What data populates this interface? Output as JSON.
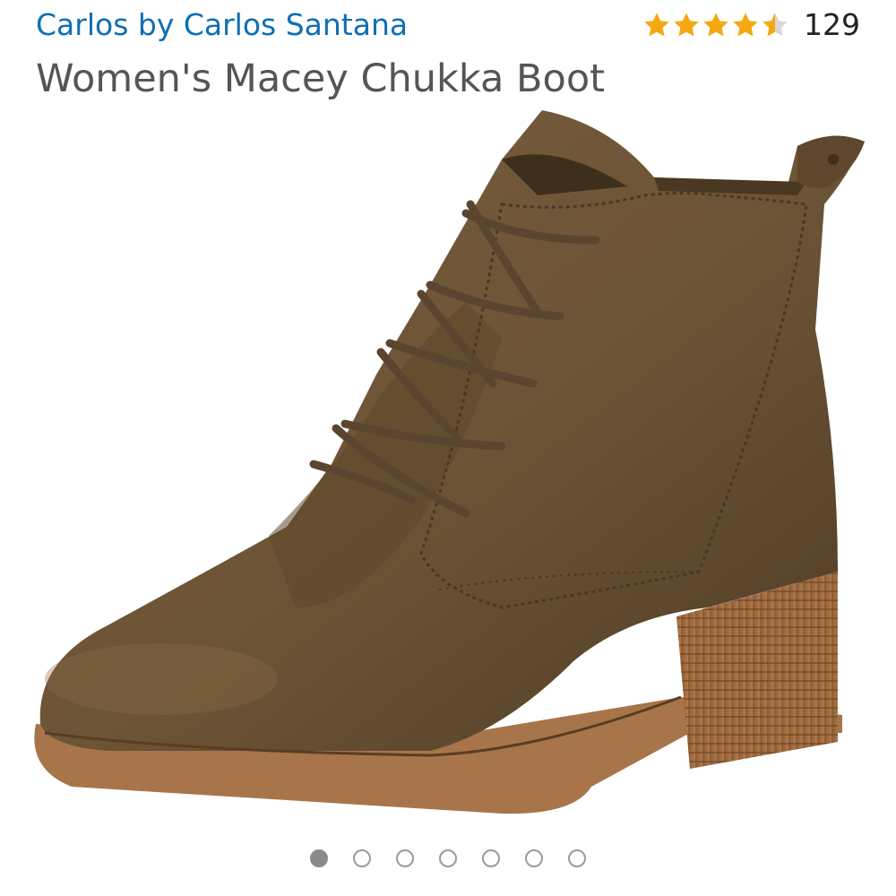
{
  "product": {
    "brand": "Carlos by Carlos Santana",
    "title": "Women's Macey Chukka Boot",
    "rating": {
      "stars": 4.5,
      "max_stars": 5,
      "review_count": "129",
      "star_color": "#f4a812",
      "empty_star_color": "#d8d8d8"
    },
    "image": {
      "subject": "boot-photo",
      "upper_color": "#6b5335",
      "sole_color": "#a8754a"
    }
  },
  "carousel": {
    "total": 7,
    "active_index": 0
  },
  "colors": {
    "brand_link": "#0f6fb3",
    "title_text": "#555555"
  }
}
